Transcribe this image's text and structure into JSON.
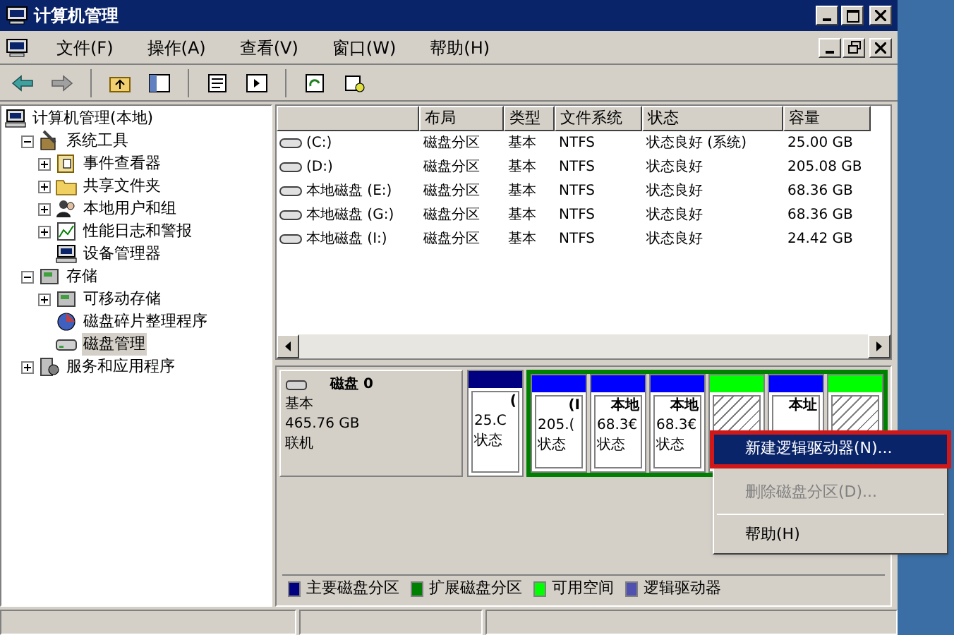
{
  "window": {
    "title": "计算机管理"
  },
  "menu": [
    {
      "label": "文件(F)"
    },
    {
      "label": "操作(A)"
    },
    {
      "label": "查看(V)"
    },
    {
      "label": "窗口(W)"
    },
    {
      "label": "帮助(H)"
    }
  ],
  "tree": {
    "label": "计算机管理(本地)",
    "children": [
      {
        "label": "系统工具",
        "expanded": true,
        "children": [
          {
            "label": "事件查看器",
            "expanded": false
          },
          {
            "label": "共享文件夹",
            "expanded": false
          },
          {
            "label": "本地用户和组",
            "expanded": false
          },
          {
            "label": "性能日志和警报",
            "expanded": false
          },
          {
            "label": "设备管理器"
          }
        ]
      },
      {
        "label": "存储",
        "expanded": true,
        "children": [
          {
            "label": "可移动存储",
            "expanded": false
          },
          {
            "label": "磁盘碎片整理程序"
          },
          {
            "label": "磁盘管理",
            "selected": true
          }
        ]
      },
      {
        "label": "服务和应用程序",
        "expanded": false
      }
    ]
  },
  "volumes": {
    "columns": [
      "布局",
      "类型",
      "文件系统",
      "状态",
      "容量"
    ],
    "rows": [
      {
        "name": "(C:)",
        "cells": [
          "磁盘分区",
          "基本",
          "NTFS",
          "状态良好 (系统)",
          "25.00 GB"
        ]
      },
      {
        "name": "(D:)",
        "cells": [
          "磁盘分区",
          "基本",
          "NTFS",
          "状态良好",
          "205.08 GB"
        ]
      },
      {
        "name": "本地磁盘 (E:)",
        "cells": [
          "磁盘分区",
          "基本",
          "NTFS",
          "状态良好",
          "68.36 GB"
        ]
      },
      {
        "name": "本地磁盘 (G:)",
        "cells": [
          "磁盘分区",
          "基本",
          "NTFS",
          "状态良好",
          "68.36 GB"
        ]
      },
      {
        "name": "本地磁盘 (I:)",
        "cells": [
          "磁盘分区",
          "基本",
          "NTFS",
          "状态良好",
          "24.42 GB"
        ]
      }
    ]
  },
  "disk": {
    "name": "磁盘 0",
    "type": "基本",
    "size": "465.76 GB",
    "status": "联机",
    "partitions": [
      {
        "kind": "primary",
        "lines": [
          "(",
          "25.C",
          "状态"
        ]
      },
      {
        "kind": "logical",
        "extended": true,
        "lines": [
          "(I",
          "205.(",
          "状态"
        ]
      },
      {
        "kind": "logical",
        "extended": true,
        "lines": [
          "本地",
          "68.3€",
          "状态"
        ]
      },
      {
        "kind": "logical",
        "extended": true,
        "lines": [
          "本地",
          "68.3€",
          "状态"
        ]
      },
      {
        "kind": "free",
        "extended": true
      },
      {
        "kind": "logical",
        "extended": true,
        "lines": [
          "本址"
        ]
      },
      {
        "kind": "free",
        "extended": true
      }
    ]
  },
  "legend": [
    {
      "label": "主要磁盘分区",
      "color": "#000080"
    },
    {
      "label": "扩展磁盘分区",
      "color": "#008000"
    },
    {
      "label": "可用空间",
      "color": "#00ff00"
    },
    {
      "label": "逻辑驱动器",
      "color": "#5050b0"
    }
  ],
  "context_menu": [
    {
      "kind": "item",
      "label": "新建逻辑驱动器(N)...",
      "selected": true,
      "disabled": false
    },
    {
      "kind": "item",
      "label": "删除磁盘分区(D)...",
      "selected": false,
      "disabled": true
    },
    {
      "kind": "separator"
    },
    {
      "kind": "item",
      "label": "帮助(H)",
      "selected": false,
      "disabled": false
    }
  ]
}
